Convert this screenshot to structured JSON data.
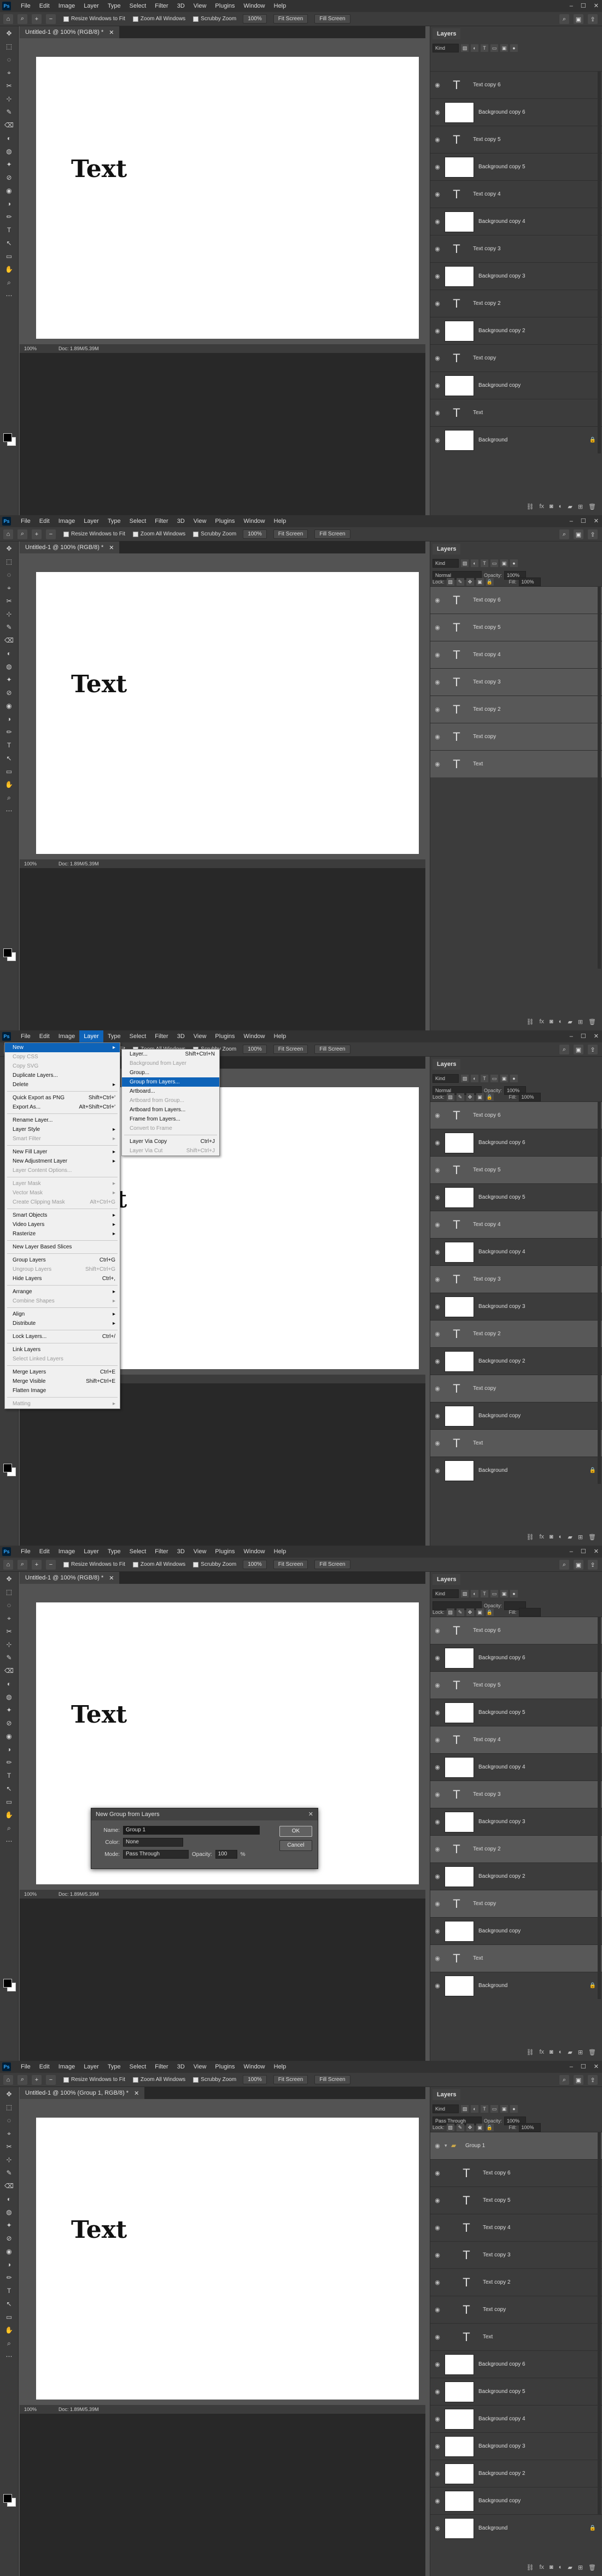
{
  "app": {
    "menus": [
      "File",
      "Edit",
      "Image",
      "Layer",
      "Type",
      "Select",
      "Filter",
      "3D",
      "View",
      "Plugins",
      "Window",
      "Help"
    ],
    "options": {
      "resize_windows": "Resize Windows to Fit",
      "zoom_all": "Zoom All Windows",
      "scrubby": "Scrubby Zoom",
      "zoom_100": "100%",
      "fit_screen": "Fit Screen",
      "fill_screen": "Fill Screen"
    },
    "canvas_text": "Text",
    "zoom_status": "100%",
    "doc_size": "Doc: 1.89M/5.39M"
  },
  "frames": [
    {
      "doc_title": "Untitled-1 @ 100% (RGB/8) *",
      "show_blend": false,
      "layers": [
        {
          "name": "Text copy 6",
          "kind": "text"
        },
        {
          "name": "Background copy 6",
          "kind": "image"
        },
        {
          "name": "Text copy 5",
          "kind": "text"
        },
        {
          "name": "Background copy 5",
          "kind": "image"
        },
        {
          "name": "Text copy 4",
          "kind": "text"
        },
        {
          "name": "Background copy 4",
          "kind": "image"
        },
        {
          "name": "Text copy 3",
          "kind": "text"
        },
        {
          "name": "Background copy 3",
          "kind": "image"
        },
        {
          "name": "Text copy 2",
          "kind": "text"
        },
        {
          "name": "Background copy 2",
          "kind": "image"
        },
        {
          "name": "Text copy",
          "kind": "text"
        },
        {
          "name": "Background copy",
          "kind": "image"
        },
        {
          "name": "Text",
          "kind": "text"
        },
        {
          "name": "Background",
          "kind": "image",
          "locked": true
        }
      ]
    },
    {
      "doc_title": "Untitled-1 @ 100% (RGB/8) *",
      "show_blend": true,
      "blend": "Normal",
      "opacity_label": "Opacity:",
      "opacity": "100%",
      "lock_label": "Lock:",
      "fill_label": "Fill:",
      "fill": "100%",
      "layers": [
        {
          "name": "Text copy 6",
          "kind": "text",
          "selected": true
        },
        {
          "name": "Text copy 5",
          "kind": "text",
          "selected": true
        },
        {
          "name": "Text copy 4",
          "kind": "text",
          "selected": true
        },
        {
          "name": "Text copy 3",
          "kind": "text",
          "selected": true
        },
        {
          "name": "Text copy 2",
          "kind": "text",
          "selected": true
        },
        {
          "name": "Text copy",
          "kind": "text",
          "selected": true
        },
        {
          "name": "Text",
          "kind": "text",
          "selected": true
        }
      ]
    },
    {
      "doc_title": "Untitled-1 @ 100% (RGB/8) *",
      "show_blend": true,
      "blend": "Normal",
      "opacity_label": "Opacity:",
      "opacity": "100%",
      "lock_label": "Lock:",
      "fill_label": "Fill:",
      "fill": "100%",
      "layers": [
        {
          "name": "Text copy 6",
          "kind": "text",
          "selected": true
        },
        {
          "name": "Background copy 6",
          "kind": "image"
        },
        {
          "name": "Text copy 5",
          "kind": "text",
          "selected": true
        },
        {
          "name": "Background copy 5",
          "kind": "image"
        },
        {
          "name": "Text copy 4",
          "kind": "text",
          "selected": true
        },
        {
          "name": "Background copy 4",
          "kind": "image"
        },
        {
          "name": "Text copy 3",
          "kind": "text",
          "selected": true
        },
        {
          "name": "Background copy 3",
          "kind": "image"
        },
        {
          "name": "Text copy 2",
          "kind": "text",
          "selected": true
        },
        {
          "name": "Background copy 2",
          "kind": "image"
        },
        {
          "name": "Text copy",
          "kind": "text",
          "selected": true
        },
        {
          "name": "Background copy",
          "kind": "image"
        },
        {
          "name": "Text",
          "kind": "text",
          "selected": true
        },
        {
          "name": "Background",
          "kind": "image",
          "locked": true
        }
      ],
      "layer_menu": [
        {
          "label": "New",
          "sub": true,
          "hl": true
        },
        {
          "label": "Copy CSS",
          "dim": true
        },
        {
          "label": "Copy SVG",
          "dim": true
        },
        {
          "label": "Duplicate Layers..."
        },
        {
          "label": "Delete",
          "sub": true
        },
        {
          "sep": true
        },
        {
          "label": "Quick Export as PNG",
          "sc": "Shift+Ctrl+'"
        },
        {
          "label": "Export As...",
          "sc": "Alt+Shift+Ctrl+'"
        },
        {
          "sep": true
        },
        {
          "label": "Rename Layer..."
        },
        {
          "label": "Layer Style",
          "sub": true
        },
        {
          "label": "Smart Filter",
          "dim": true,
          "sub": true
        },
        {
          "sep": true
        },
        {
          "label": "New Fill Layer",
          "sub": true
        },
        {
          "label": "New Adjustment Layer",
          "sub": true
        },
        {
          "label": "Layer Content Options...",
          "dim": true
        },
        {
          "sep": true
        },
        {
          "label": "Layer Mask",
          "dim": true,
          "sub": true
        },
        {
          "label": "Vector Mask",
          "dim": true,
          "sub": true
        },
        {
          "label": "Create Clipping Mask",
          "dim": true,
          "sc": "Alt+Ctrl+G"
        },
        {
          "sep": true
        },
        {
          "label": "Smart Objects",
          "sub": true
        },
        {
          "label": "Video Layers",
          "sub": true
        },
        {
          "label": "Rasterize",
          "sub": true
        },
        {
          "sep": true
        },
        {
          "label": "New Layer Based Slices"
        },
        {
          "sep": true
        },
        {
          "label": "Group Layers",
          "sc": "Ctrl+G"
        },
        {
          "label": "Ungroup Layers",
          "dim": true,
          "sc": "Shift+Ctrl+G"
        },
        {
          "label": "Hide Layers",
          "sc": "Ctrl+,"
        },
        {
          "sep": true
        },
        {
          "label": "Arrange",
          "sub": true
        },
        {
          "label": "Combine Shapes",
          "dim": true,
          "sub": true
        },
        {
          "sep": true
        },
        {
          "label": "Align",
          "sub": true
        },
        {
          "label": "Distribute",
          "sub": true
        },
        {
          "sep": true
        },
        {
          "label": "Lock Layers...",
          "sc": "Ctrl+/"
        },
        {
          "sep": true
        },
        {
          "label": "Link Layers"
        },
        {
          "label": "Select Linked Layers",
          "dim": true
        },
        {
          "sep": true
        },
        {
          "label": "Merge Layers",
          "sc": "Ctrl+E"
        },
        {
          "label": "Merge Visible",
          "sc": "Shift+Ctrl+E"
        },
        {
          "label": "Flatten Image"
        },
        {
          "sep": true
        },
        {
          "label": "Matting",
          "dim": true,
          "sub": true
        }
      ],
      "new_submenu": [
        {
          "label": "Layer...",
          "sc": "Shift+Ctrl+N"
        },
        {
          "label": "Background from Layer",
          "dim": true
        },
        {
          "label": "Group..."
        },
        {
          "label": "Group from Layers...",
          "hl": true
        },
        {
          "label": "Artboard..."
        },
        {
          "label": "Artboard from Group...",
          "dim": true
        },
        {
          "label": "Artboard from Layers..."
        },
        {
          "label": "Frame from Layers..."
        },
        {
          "label": "Convert to Frame",
          "dim": true
        },
        {
          "sep": true
        },
        {
          "label": "Layer Via Copy",
          "sc": "Ctrl+J"
        },
        {
          "label": "Layer Via Cut",
          "dim": true,
          "sc": "Shift+Ctrl+J"
        }
      ]
    },
    {
      "doc_title": "Untitled-1 @ 100% (RGB/8) *",
      "show_blend": true,
      "blend": "",
      "opacity_label": "Opacity:",
      "opacity": "",
      "lock_label": "Lock:",
      "fill_label": "Fill:",
      "fill": "",
      "layers": [
        {
          "name": "Text copy 6",
          "kind": "text",
          "selected": true
        },
        {
          "name": "Background copy 6",
          "kind": "image"
        },
        {
          "name": "Text copy 5",
          "kind": "text",
          "selected": true
        },
        {
          "name": "Background copy 5",
          "kind": "image"
        },
        {
          "name": "Text copy 4",
          "kind": "text",
          "selected": true
        },
        {
          "name": "Background copy 4",
          "kind": "image"
        },
        {
          "name": "Text copy 3",
          "kind": "text",
          "selected": true
        },
        {
          "name": "Background copy 3",
          "kind": "image"
        },
        {
          "name": "Text copy 2",
          "kind": "text",
          "selected": true
        },
        {
          "name": "Background copy 2",
          "kind": "image"
        },
        {
          "name": "Text copy",
          "kind": "text",
          "selected": true
        },
        {
          "name": "Background copy",
          "kind": "image"
        },
        {
          "name": "Text",
          "kind": "text",
          "selected": true
        },
        {
          "name": "Background",
          "kind": "image",
          "locked": true
        }
      ],
      "dialog": {
        "title": "New Group from Layers",
        "name_label": "Name:",
        "name_value": "Group 1",
        "color_label": "Color:",
        "color_value": "None",
        "mode_label": "Mode:",
        "mode_value": "Pass Through",
        "opacity_label": "Opacity:",
        "opacity_value": "100",
        "pct": "%",
        "ok": "OK",
        "cancel": "Cancel"
      }
    },
    {
      "doc_title": "Untitled-1 @ 100% (Group 1, RGB/8) *",
      "show_blend": true,
      "blend": "Pass Through",
      "opacity_label": "Opacity:",
      "opacity": "100%",
      "lock_label": "Lock:",
      "fill_label": "Fill:",
      "fill": "100%",
      "layers": [
        {
          "name": "Group 1",
          "kind": "group",
          "selected": true
        },
        {
          "name": "Text copy 6",
          "kind": "text",
          "indent": true
        },
        {
          "name": "Text copy 5",
          "kind": "text",
          "indent": true
        },
        {
          "name": "Text copy 4",
          "kind": "text",
          "indent": true
        },
        {
          "name": "Text copy 3",
          "kind": "text",
          "indent": true
        },
        {
          "name": "Text copy 2",
          "kind": "text",
          "indent": true
        },
        {
          "name": "Text copy",
          "kind": "text",
          "indent": true
        },
        {
          "name": "Text",
          "kind": "text",
          "indent": true
        },
        {
          "name": "Background copy 6",
          "kind": "image"
        },
        {
          "name": "Background copy 5",
          "kind": "image"
        },
        {
          "name": "Background copy 4",
          "kind": "image"
        },
        {
          "name": "Background copy 3",
          "kind": "image"
        },
        {
          "name": "Background copy 2",
          "kind": "image"
        },
        {
          "name": "Background copy",
          "kind": "image"
        },
        {
          "name": "Background",
          "kind": "image",
          "locked": true
        }
      ]
    }
  ],
  "panel": {
    "tab": "Layers",
    "kind": "Kind"
  }
}
